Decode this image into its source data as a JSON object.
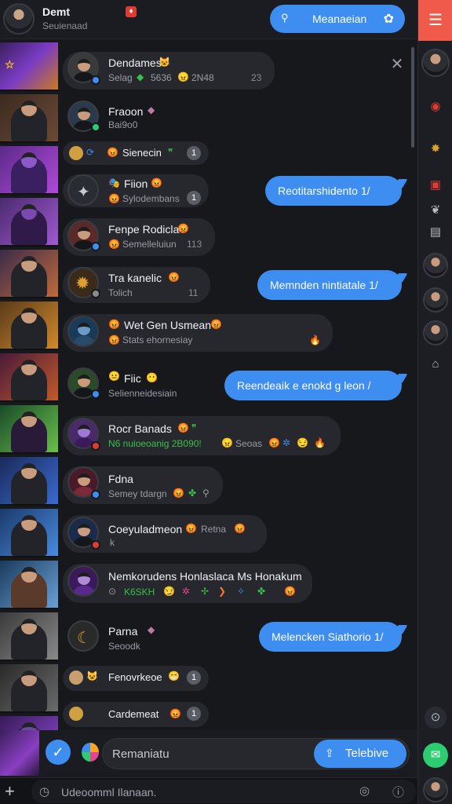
{
  "header": {
    "title": "Demt",
    "subtitle": "Seuienaad",
    "action_label": "Meanaeian"
  },
  "chats": [
    {
      "name": "Dendames",
      "msg": "Selag",
      "extra": "5636",
      "time": "23",
      "meta": "2N48"
    },
    {
      "name": "Fraoon",
      "msg": "Bai9o0"
    },
    {
      "name": "Sienecin",
      "count": "1"
    },
    {
      "name": "Fiion",
      "msg": "Sylodembans",
      "count": "1"
    },
    {
      "name": "Fenpe Rodicla",
      "msg": "Semelleluiun",
      "time": "113"
    },
    {
      "name": "Tra kanelic",
      "msg": "Tolich",
      "time": "11"
    },
    {
      "name": "Wet Gen Usmean",
      "msg": "Stats ehornesiay"
    },
    {
      "name": "Fiic",
      "msg": "Selienneidesiain"
    },
    {
      "name": "Rocr Banads",
      "msg": "N6 nuioeoanig 2B090!",
      "extra": "Seoas"
    },
    {
      "name": "Fdna",
      "msg": "Semey tdargn"
    },
    {
      "name": "Coeyuladmeon",
      "msg": "k",
      "extra": "Retna"
    },
    {
      "name": "Nemkorudens Honlaslaca Ms Honakum",
      "msg": "K6SKH"
    },
    {
      "name": "Parna",
      "msg": "Seoodk"
    },
    {
      "name": "Fenovrkeoe",
      "count": "1"
    },
    {
      "name": "Cardemeat",
      "count": "1"
    }
  ],
  "replies": [
    "Reotitarshidento 1/",
    "Memnden nintiatale 1/",
    "Reendeaik e enokd g leon /",
    "Melencken Siathorio 1/"
  ],
  "composer": {
    "input_text": "Remaniatu",
    "send_label": "Telebive"
  },
  "bottom": {
    "input_text": "Udeoomml Ilanaan."
  },
  "colors": {
    "accent": "#3d8ef0",
    "menu": "#f05a4a",
    "bubble": "#26282e",
    "background": "#17181c"
  }
}
